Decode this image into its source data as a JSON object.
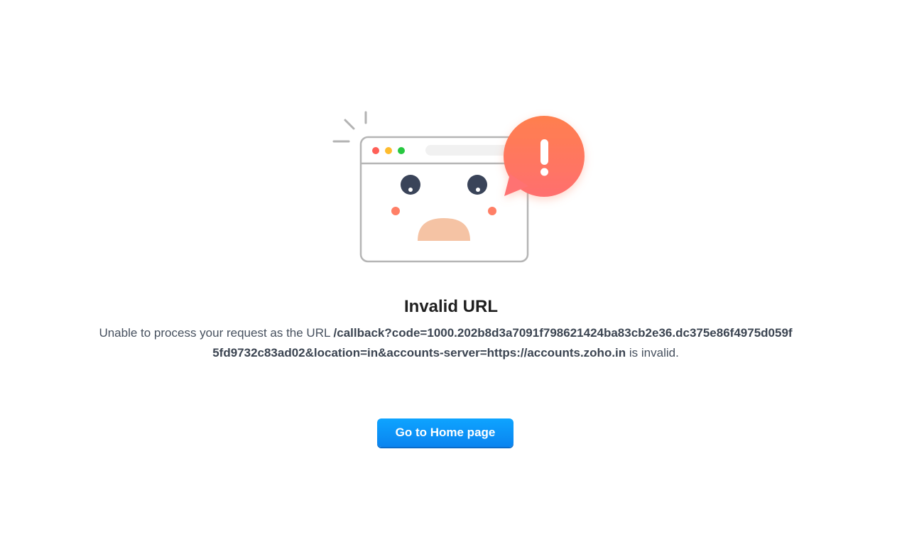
{
  "error": {
    "title": "Invalid URL",
    "message_prefix": "Unable to process your request as the URL ",
    "url": "/callback?code=1000.202b8d3a7091f798621424ba83cb2e36.dc375e86f4975d059f5fd9732c83ad02&location=in&accounts-server=https://accounts.zoho.in",
    "message_suffix": " is invalid."
  },
  "actions": {
    "home_label": "Go to Home page"
  },
  "colors": {
    "alert_bubble": "#ff7b5a",
    "button": "#0a8ef5",
    "mouth": "#f5c3a4",
    "cheeks": "#ff7f66",
    "eyes": "#3a4459"
  },
  "icons": [
    "browser-window-icon",
    "alert-bubble-icon",
    "exclamation-icon"
  ]
}
